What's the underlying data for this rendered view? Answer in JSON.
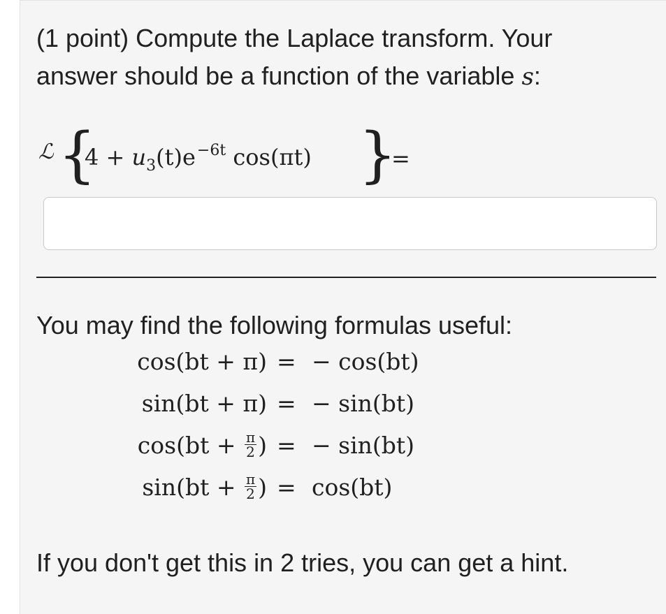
{
  "problem": {
    "intro_line1": "(1 point) Compute the Laplace transform. Your",
    "intro_line2_prefix": "answer should be a function of the variable ",
    "variable": "s",
    "intro_line2_suffix": ":",
    "laplace_symbol": "ℒ",
    "brace_open": "{",
    "expression_const": "4 + ",
    "expression_u": "u",
    "expression_u_sub": "3",
    "expression_t": "(t)e",
    "expression_exp": "−6t",
    "expression_cos": " cos(πt)",
    "brace_close": "}",
    "equals": "="
  },
  "answer": {
    "value": "",
    "placeholder": ""
  },
  "formulas": {
    "intro": "You may find the following formulas useful:",
    "rows": [
      {
        "lhs": "cos(bt + π)",
        "eq": "=",
        "rhs": "− cos(bt)"
      },
      {
        "lhs": "sin(bt + π)",
        "eq": "=",
        "rhs": "− sin(bt)"
      },
      {
        "lhs_prefix": "cos(bt + ",
        "frac_num": "π",
        "frac_den": "2",
        "lhs_suffix": ")",
        "eq": "=",
        "rhs": "− sin(bt)"
      },
      {
        "lhs_prefix": "sin(bt + ",
        "frac_num": "π",
        "frac_den": "2",
        "lhs_suffix": ")",
        "eq": "=",
        "rhs": "cos(bt)"
      }
    ]
  },
  "footer": {
    "hint_text": "If you don't get this in 2 tries, you can get a hint."
  }
}
